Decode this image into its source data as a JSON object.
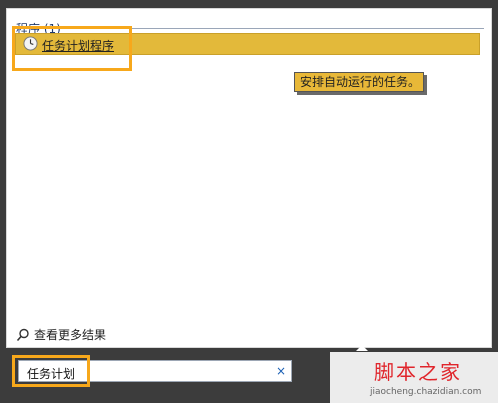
{
  "section": {
    "title": "程序 (1)"
  },
  "result": {
    "label": "任务计划程序",
    "icon": "clock-icon"
  },
  "tooltip": {
    "text": "安排自动运行的任务。"
  },
  "see_more": {
    "label": "查看更多结果",
    "icon": "search-icon"
  },
  "search": {
    "value": "任务计划",
    "clear": "×"
  },
  "watermark": {
    "main": "脚本之家",
    "sub": "jiaocheng.chazidian.com"
  },
  "colors": {
    "highlight": "#e3b93a",
    "annotation": "#f7a81b",
    "tooltip": "#e8b838"
  }
}
